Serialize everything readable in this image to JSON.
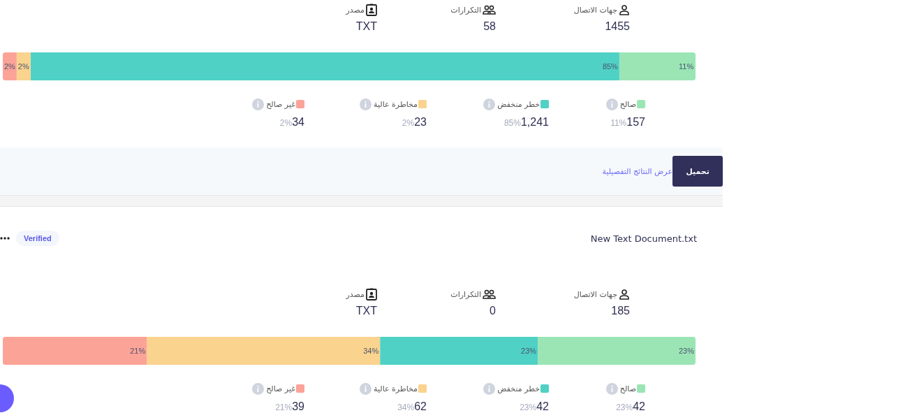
{
  "cards": [
    {
      "stats": [
        {
          "kind": "contacts",
          "label": "جهات الاتصال",
          "value": "1455"
        },
        {
          "kind": "duplicates",
          "label": "التكرارات",
          "value": "58"
        },
        {
          "kind": "source",
          "label": "مصدر",
          "value": "TXT"
        }
      ],
      "chart_data": {
        "type": "bar",
        "orientation": "horizontal",
        "stacked": true,
        "series": [
          {
            "color": "#9be5b5",
            "values": [
              11
            ],
            "value_labels": [
              "11%"
            ]
          },
          {
            "color": "#4fd1c5",
            "values": [
              85
            ],
            "value_labels": [
              "85%"
            ]
          },
          {
            "color": "#fad38e",
            "values": [
              2
            ],
            "value_labels": [
              "2%"
            ]
          },
          {
            "color": "#fca397",
            "values": [
              2
            ],
            "value_labels": [
              "2%"
            ]
          }
        ]
      },
      "legend": [
        {
          "label": "صالح",
          "value": "157",
          "percent": "11%",
          "color": "#9be5b5"
        },
        {
          "label": "خطر منخفض",
          "value": "1,241",
          "percent": "85%",
          "color": "#4fd1c5"
        },
        {
          "label": "مخاطرة عالية",
          "value": "23",
          "percent": "2%",
          "color": "#fad38e"
        },
        {
          "label": "غير صالح",
          "value": "34",
          "percent": "2%",
          "color": "#fca397"
        }
      ],
      "footer": {
        "link": "عرض النتائج التفصيلية",
        "button": "تحميل"
      }
    },
    {
      "header": {
        "file": "New Text Document.txt",
        "badge": "Verified"
      },
      "stats": [
        {
          "kind": "contacts",
          "label": "جهات الاتصال",
          "value": "185"
        },
        {
          "kind": "duplicates",
          "label": "التكرارات",
          "value": "0"
        },
        {
          "kind": "source",
          "label": "مصدر",
          "value": "TXT"
        }
      ],
      "chart_data": {
        "type": "bar",
        "orientation": "horizontal",
        "stacked": true,
        "series": [
          {
            "color": "#9be5b5",
            "values": [
              23
            ],
            "value_labels": [
              "23%"
            ]
          },
          {
            "color": "#4fd1c5",
            "values": [
              23
            ],
            "value_labels": [
              "23%"
            ]
          },
          {
            "color": "#fad38e",
            "values": [
              34
            ],
            "value_labels": [
              "34%"
            ]
          },
          {
            "color": "#fca397",
            "values": [
              21
            ],
            "value_labels": [
              "21%"
            ]
          }
        ]
      },
      "legend": [
        {
          "label": "صالح",
          "value": "42",
          "percent": "23%",
          "color": "#9be5b5"
        },
        {
          "label": "خطر منخفض",
          "value": "42",
          "percent": "23%",
          "color": "#4fd1c5"
        },
        {
          "label": "مخاطرة عالية",
          "value": "62",
          "percent": "34%",
          "color": "#fad38e"
        },
        {
          "label": "غير صالح",
          "value": "39",
          "percent": "21%",
          "color": "#fca397"
        }
      ]
    }
  ]
}
